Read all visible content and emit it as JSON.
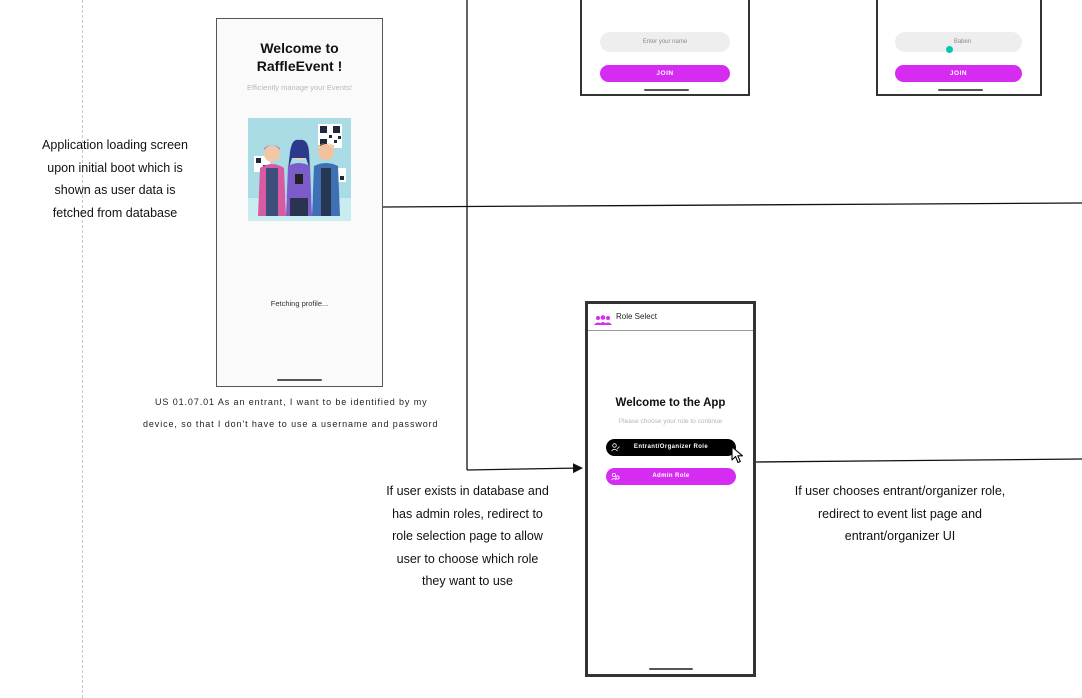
{
  "notes": {
    "loading_screen": [
      "Application loading screen",
      "upon initial boot which is",
      "shown as user data is",
      "fetched from database"
    ],
    "user_story": [
      "US 01.07.01 As an entrant, I want to be identified by my",
      "device, so that I don't have to use a username and password"
    ],
    "admin_redirect": [
      "If user exists in database and",
      "has admin roles, redirect to",
      "role selection page to allow",
      "user to choose which role",
      "they want to use"
    ],
    "entrant_redirect": [
      "If user chooses entrant/organizer role,",
      "redirect to event list page and",
      "entrant/organizer UI"
    ]
  },
  "loading_phone": {
    "title_line1": "Welcome to",
    "title_line2": "RaffleEvent !",
    "tagline": "Efficiently manage your Events!",
    "status": "Fetching profile..."
  },
  "join_phone_left": {
    "name_placeholder": "Enter your name",
    "join_label": "JOIN"
  },
  "join_phone_right": {
    "name_value": "Baben",
    "join_label": "JOIN"
  },
  "role_phone": {
    "appbar_title": "Role Select",
    "welcome": "Welcome to the App",
    "subtitle": "Please choose your role to continue",
    "entrant_button": "Entrant/Organizer Role",
    "admin_button": "Admin Role"
  },
  "colors": {
    "accent": "#d62bf0",
    "dark_button": "#000000",
    "cursor_dot": "#00c8b4"
  },
  "icons": {
    "appbar": "people-group-icon",
    "entrant": "person-edit-icon",
    "admin": "admin-people-icon",
    "cursor": "mouse-pointer-icon"
  }
}
